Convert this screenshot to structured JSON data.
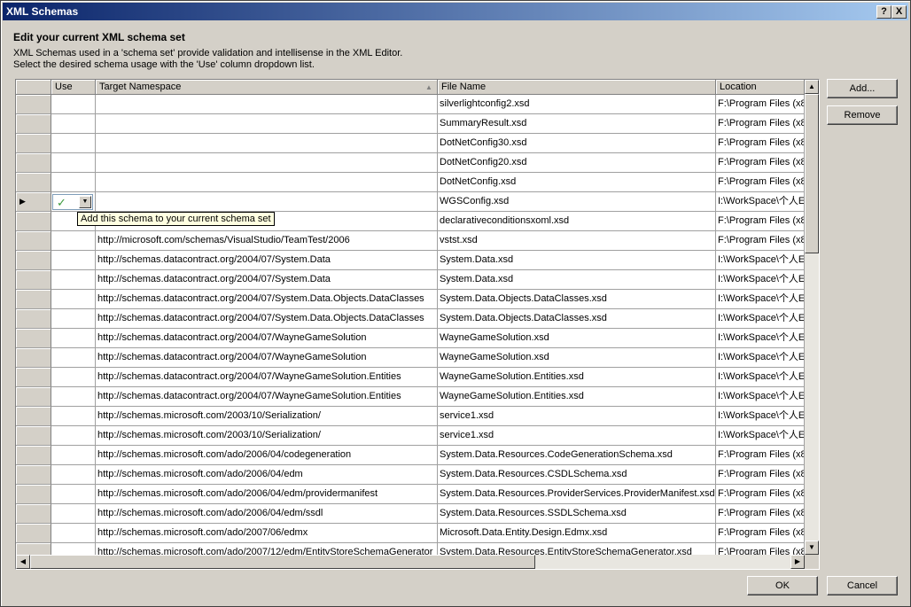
{
  "window": {
    "title": "XML Schemas",
    "help_glyph": "?",
    "close_glyph": "X"
  },
  "heading": "Edit your current XML schema set",
  "description": [
    "XML Schemas used in a 'schema set' provide validation and intellisense in the XML Editor.",
    "Select the desired schema usage with the 'Use' column dropdown list."
  ],
  "columns": {
    "use": "Use",
    "target_namespace": "Target Namespace",
    "file_name": "File Name",
    "location": "Location"
  },
  "rows": [
    {
      "use": "",
      "ns": "",
      "file": "silverlightconfig2.xsd",
      "loc": "F:\\Program Files (x8"
    },
    {
      "use": "",
      "ns": "",
      "file": "SummaryResult.xsd",
      "loc": "F:\\Program Files (x8"
    },
    {
      "use": "",
      "ns": "",
      "file": "DotNetConfig30.xsd",
      "loc": "F:\\Program Files (x8"
    },
    {
      "use": "",
      "ns": "",
      "file": "DotNetConfig20.xsd",
      "loc": "F:\\Program Files (x8"
    },
    {
      "use": "",
      "ns": "",
      "file": "DotNetConfig.xsd",
      "loc": "F:\\Program Files (x8"
    },
    {
      "use": "",
      "ns": "",
      "file": "WGSConfig.xsd",
      "loc": "I:\\WorkSpace\\个人E"
    },
    {
      "use": "",
      "ns": "",
      "file": "declarativeconditionsxoml.xsd",
      "loc": "F:\\Program Files (x8"
    },
    {
      "use": "",
      "ns": "http://microsoft.com/schemas/VisualStudio/TeamTest/2006",
      "file": "vstst.xsd",
      "loc": "F:\\Program Files (x8"
    },
    {
      "use": "",
      "ns": "http://schemas.datacontract.org/2004/07/System.Data",
      "file": "System.Data.xsd",
      "loc": "I:\\WorkSpace\\个人E"
    },
    {
      "use": "",
      "ns": "http://schemas.datacontract.org/2004/07/System.Data",
      "file": "System.Data.xsd",
      "loc": "I:\\WorkSpace\\个人E"
    },
    {
      "use": "",
      "ns": "http://schemas.datacontract.org/2004/07/System.Data.Objects.DataClasses",
      "file": "System.Data.Objects.DataClasses.xsd",
      "loc": "I:\\WorkSpace\\个人E"
    },
    {
      "use": "",
      "ns": "http://schemas.datacontract.org/2004/07/System.Data.Objects.DataClasses",
      "file": "System.Data.Objects.DataClasses.xsd",
      "loc": "I:\\WorkSpace\\个人E"
    },
    {
      "use": "",
      "ns": "http://schemas.datacontract.org/2004/07/WayneGameSolution",
      "file": "WayneGameSolution.xsd",
      "loc": "I:\\WorkSpace\\个人E"
    },
    {
      "use": "",
      "ns": "http://schemas.datacontract.org/2004/07/WayneGameSolution",
      "file": "WayneGameSolution.xsd",
      "loc": "I:\\WorkSpace\\个人E"
    },
    {
      "use": "",
      "ns": "http://schemas.datacontract.org/2004/07/WayneGameSolution.Entities",
      "file": "WayneGameSolution.Entities.xsd",
      "loc": "I:\\WorkSpace\\个人E"
    },
    {
      "use": "",
      "ns": "http://schemas.datacontract.org/2004/07/WayneGameSolution.Entities",
      "file": "WayneGameSolution.Entities.xsd",
      "loc": "I:\\WorkSpace\\个人E"
    },
    {
      "use": "",
      "ns": "http://schemas.microsoft.com/2003/10/Serialization/",
      "file": "service1.xsd",
      "loc": "I:\\WorkSpace\\个人E"
    },
    {
      "use": "",
      "ns": "http://schemas.microsoft.com/2003/10/Serialization/",
      "file": "service1.xsd",
      "loc": "I:\\WorkSpace\\个人E"
    },
    {
      "use": "",
      "ns": "http://schemas.microsoft.com/ado/2006/04/codegeneration",
      "file": "System.Data.Resources.CodeGenerationSchema.xsd",
      "loc": "F:\\Program Files (x8"
    },
    {
      "use": "",
      "ns": "http://schemas.microsoft.com/ado/2006/04/edm",
      "file": "System.Data.Resources.CSDLSchema.xsd",
      "loc": "F:\\Program Files (x8"
    },
    {
      "use": "",
      "ns": "http://schemas.microsoft.com/ado/2006/04/edm/providermanifest",
      "file": "System.Data.Resources.ProviderServices.ProviderManifest.xsd",
      "loc": "F:\\Program Files (x8"
    },
    {
      "use": "",
      "ns": "http://schemas.microsoft.com/ado/2006/04/edm/ssdl",
      "file": "System.Data.Resources.SSDLSchema.xsd",
      "loc": "F:\\Program Files (x8"
    },
    {
      "use": "",
      "ns": "http://schemas.microsoft.com/ado/2007/06/edmx",
      "file": "Microsoft.Data.Entity.Design.Edmx.xsd",
      "loc": "F:\\Program Files (x8"
    },
    {
      "use": "",
      "ns": "http://schemas.microsoft.com/ado/2007/12/edm/EntityStoreSchemaGenerator",
      "file": "System.Data.Resources.EntityStoreSchemaGenerator.xsd",
      "loc": "F:\\Program Files (x8"
    }
  ],
  "current_row_index": 5,
  "current_row_marker": "▶",
  "use_combo": {
    "value": "✓",
    "drop_glyph": "▼"
  },
  "tooltip": "Add this schema to your current schema set",
  "sort_glyph": "▲",
  "scroll_glyphs": {
    "up": "▲",
    "down": "▼",
    "left": "◀",
    "right": "▶"
  },
  "buttons": {
    "add": "Add...",
    "remove": "Remove",
    "ok": "OK",
    "cancel": "Cancel"
  },
  "colors": {
    "title_start": "#0a246a",
    "title_end": "#a6caf0",
    "tooltip_bg": "#ffffe1",
    "check": "#3c9a3c"
  }
}
